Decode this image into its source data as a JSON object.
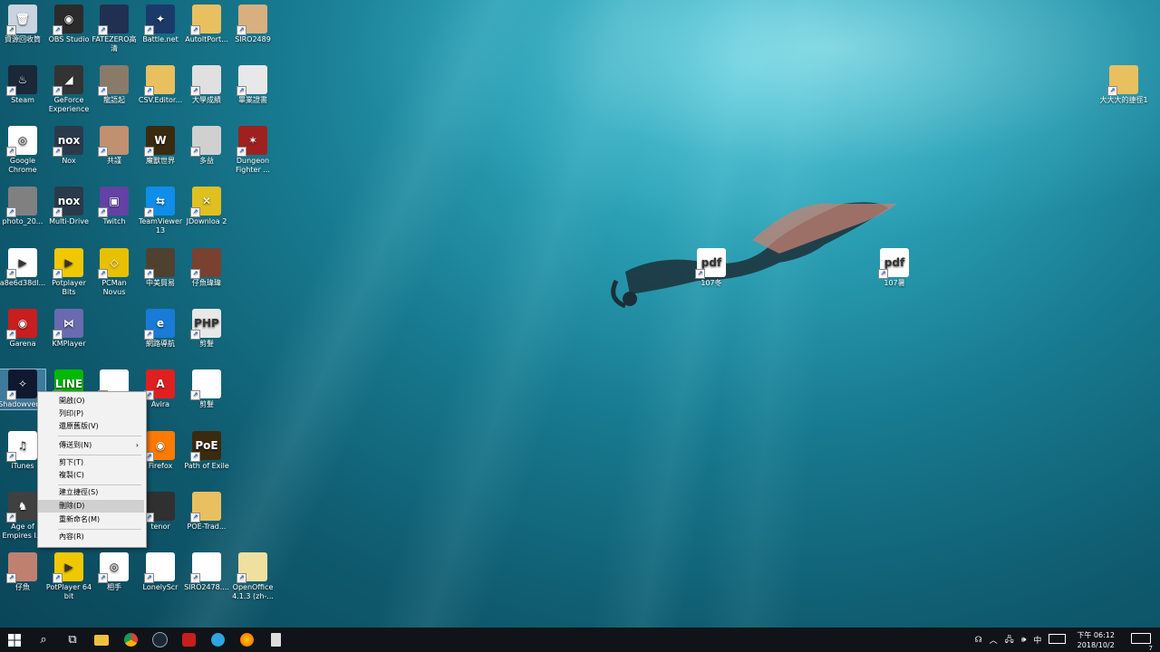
{
  "desktop": {
    "icons": [
      {
        "label": "資源回收筒",
        "color": "#c9d4e0",
        "glyph": "🗑"
      },
      {
        "label": "OBS Studio",
        "color": "#2b2b2b",
        "glyph": "◉"
      },
      {
        "label": "FATEZERO高清",
        "color": "#203050",
        "glyph": ""
      },
      {
        "label": "Battle.net",
        "color": "#1a3a6a",
        "glyph": "✦"
      },
      {
        "label": "AutoItPort...",
        "color": "#e8c060",
        "glyph": ""
      },
      {
        "label": "SIRO2489",
        "color": "#d8b080",
        "glyph": ""
      },
      {
        "label": "Steam",
        "color": "#1b2838",
        "glyph": "♨"
      },
      {
        "label": "GeForce Experience",
        "color": "#333",
        "glyph": "◢"
      },
      {
        "label": "龍語起",
        "color": "#8a7a6a",
        "glyph": ""
      },
      {
        "label": "CSV.Editor...",
        "color": "#e8c060",
        "glyph": ""
      },
      {
        "label": "大學成績",
        "color": "#e0e0e0",
        "glyph": ""
      },
      {
        "label": "畢業證書",
        "color": "#e8e8e8",
        "glyph": ""
      },
      {
        "label": "Google Chrome",
        "color": "#ffffff",
        "glyph": "◎"
      },
      {
        "label": "Nox",
        "color": "#2a3a4a",
        "glyph": "nox"
      },
      {
        "label": "共謹",
        "color": "#c09070",
        "glyph": ""
      },
      {
        "label": "魔獸世界",
        "color": "#3a2a10",
        "glyph": "W"
      },
      {
        "label": "多益",
        "color": "#d0d0d0",
        "glyph": ""
      },
      {
        "label": "Dungeon Fighter ...",
        "color": "#a02020",
        "glyph": "✶"
      },
      {
        "label": "photo_20...",
        "color": "#808080",
        "glyph": ""
      },
      {
        "label": "Multi-Drive",
        "color": "#2a3a4a",
        "glyph": "nox"
      },
      {
        "label": "Twitch",
        "color": "#6441a5",
        "glyph": "▣"
      },
      {
        "label": "TeamViewer 13",
        "color": "#0e8ee9",
        "glyph": "⇆"
      },
      {
        "label": "JDownloa 2",
        "color": "#e0c020",
        "glyph": "✕"
      },
      {
        "label": "a8e6d38dl...",
        "color": "#ffffff",
        "glyph": "▶"
      },
      {
        "label": "Potplayer Bits",
        "color": "#f0c800",
        "glyph": "▶"
      },
      {
        "label": "PCMan Novus",
        "color": "#e8c000",
        "glyph": "◇"
      },
      {
        "label": "中美貿易",
        "color": "#504030",
        "glyph": ""
      },
      {
        "label": "仔魚瑋瑋",
        "color": "#7a4030",
        "glyph": ""
      },
      {
        "label": "Garena",
        "color": "#c81e1e",
        "glyph": "◉"
      },
      {
        "label": "KMPlayer",
        "color": "#6a6ab0",
        "glyph": "⋈"
      },
      {
        "label": "網路導航",
        "color": "#1a7ad8",
        "glyph": "e"
      },
      {
        "label": "剪髮",
        "color": "#e8e8e8",
        "glyph": "PHP"
      },
      {
        "label": "Shadowverse",
        "color": "#101830",
        "glyph": "✧"
      },
      {
        "label": "",
        "color": "#00b900",
        "glyph": "LINE"
      },
      {
        "label": "",
        "color": "#ffffff",
        "glyph": ""
      },
      {
        "label": "Avira",
        "color": "#e02020",
        "glyph": "A"
      },
      {
        "label": "剪髮",
        "color": "#ffffff",
        "glyph": ""
      },
      {
        "label": "iTunes",
        "color": "#ffffff",
        "glyph": "♫"
      },
      {
        "label": "Firefox",
        "color": "#ff7a00",
        "glyph": "◉"
      },
      {
        "label": "Path of Exile",
        "color": "#3a2a10",
        "glyph": "PoE"
      },
      {
        "label": "Age of Empires I...",
        "color": "#404040",
        "glyph": "♞"
      },
      {
        "label": "tenor",
        "color": "#303030",
        "glyph": ""
      },
      {
        "label": "POE-Trad...",
        "color": "#e8c060",
        "glyph": ""
      },
      {
        "label": "仔魚",
        "color": "#c08070",
        "glyph": ""
      },
      {
        "label": "PotPlayer 64 bit",
        "color": "#f0c800",
        "glyph": "▶"
      },
      {
        "label": "相手",
        "color": "#ffffff",
        "glyph": "◎"
      },
      {
        "label": "LonelyScr",
        "color": "#ffffff",
        "glyph": ""
      },
      {
        "label": "SIRO2478....",
        "color": "#ffffff",
        "glyph": ""
      },
      {
        "label": "OpenOffice 4.1.3 (zh-...",
        "color": "#f0e0a0",
        "glyph": ""
      },
      {
        "label": "107冬",
        "color": "#ffffff",
        "glyph": "pdf"
      },
      {
        "label": "107暑",
        "color": "#ffffff",
        "glyph": "pdf"
      },
      {
        "label": "大大大的捷徑1",
        "color": "#e8c060",
        "glyph": ""
      }
    ]
  },
  "context_menu": {
    "items": [
      "開啟(O)",
      "列印(P)",
      "還原舊版(V)",
      "傳送到(N)",
      "剪下(T)",
      "複製(C)",
      "建立捷徑(S)",
      "刪除(D)",
      "重新命名(M)",
      "內容(R)"
    ],
    "highlighted": "刪除(D)",
    "submenu_arrow": "›"
  },
  "taskbar": {
    "start_icon": "windows-logo",
    "search_glyph": "⌕",
    "taskview_glyph": "⧉",
    "apps": [
      "file-explorer",
      "chrome",
      "steam",
      "garena",
      "telegram",
      "firefox",
      "calculator"
    ],
    "tray": {
      "people_glyph": "☊",
      "chevron": "︿",
      "network": "🖧",
      "volume": "🕪",
      "ime": "中",
      "clock_time": "下午 06:12",
      "clock_date": "2018/10/2",
      "notifications": "7"
    }
  }
}
